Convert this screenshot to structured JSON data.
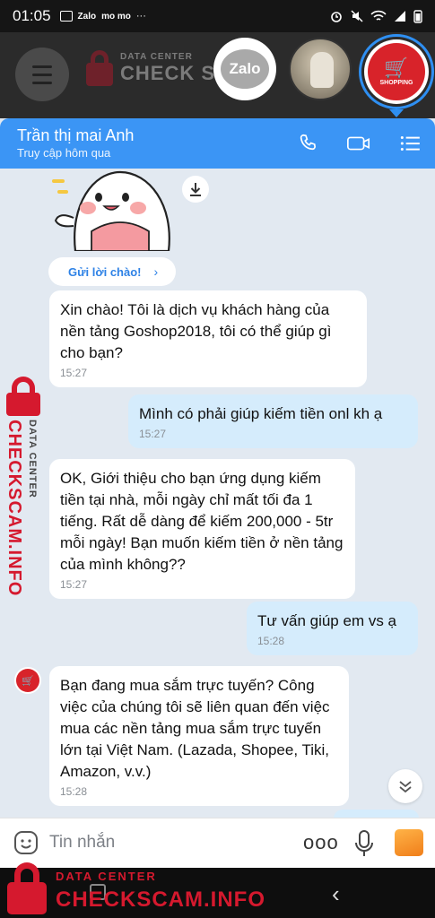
{
  "status_bar": {
    "time": "01:05",
    "notif_zalo": "Zalo",
    "notif_momo": "mo mo",
    "more": "···"
  },
  "watermark": {
    "small": "DATA CENTER",
    "top_big": "CHECK SC",
    "big": "CHECKSCAM.INFO",
    "side_big": "CHECKSCAM.INFO",
    "side_small": "DATA CENTER"
  },
  "chat_heads": {
    "zalo_label": "Zalo",
    "shop_label": "SHOPPING"
  },
  "header": {
    "contact_name": "Trần thị mai Anh",
    "last_seen": "Truy cập hôm qua"
  },
  "greet_chip": {
    "label": "Gửi lời chào!",
    "chevron": "›"
  },
  "messages": [
    {
      "dir": "in",
      "text": "Xin chào! Tôi là dịch vụ khách hàng của nền tảng Goshop2018, tôi có thể giúp gì cho bạn?",
      "time": "15:27"
    },
    {
      "dir": "out",
      "text": "Mình có phải giúp kiếm tiền onl kh ạ",
      "time": "15:27"
    },
    {
      "dir": "in",
      "text": "OK, Giới thiệu cho bạn ứng dụng kiếm tiền tại nhà, mỗi ngày chỉ mất tối đa 1 tiếng. Rất dễ dàng để kiếm 200,000 - 5tr mỗi ngày!  Bạn muốn kiếm tiền ở nền tảng của mình không??",
      "time": "15:27"
    },
    {
      "dir": "out",
      "text": "Tư vấn giúp em vs ạ",
      "time": "15:28"
    },
    {
      "dir": "in",
      "text": "Bạn đang mua sắm trực tuyến? Công việc của chúng tôi sẽ liên quan đến việc mua các nền tảng mua sắm trực tuyến lớn tại Việt Nam. (Lazada, Shopee, Tiki, Amazon, v.v.)",
      "time": "15:28"
    }
  ],
  "input_bar": {
    "placeholder": "Tin nhắn",
    "more": "ooo"
  },
  "colors": {
    "header_blue": "#3b95f5",
    "outgoing_bubble": "#d5ecfc",
    "chat_bg": "#e2e9f1",
    "watermark_red": "#d5192e"
  },
  "icons": [
    "menu-icon",
    "phone-icon",
    "video-call-icon",
    "list-menu-icon",
    "download-icon",
    "chevron-down-double-icon",
    "emoji-icon",
    "mic-icon",
    "image-icon",
    "back-icon"
  ]
}
